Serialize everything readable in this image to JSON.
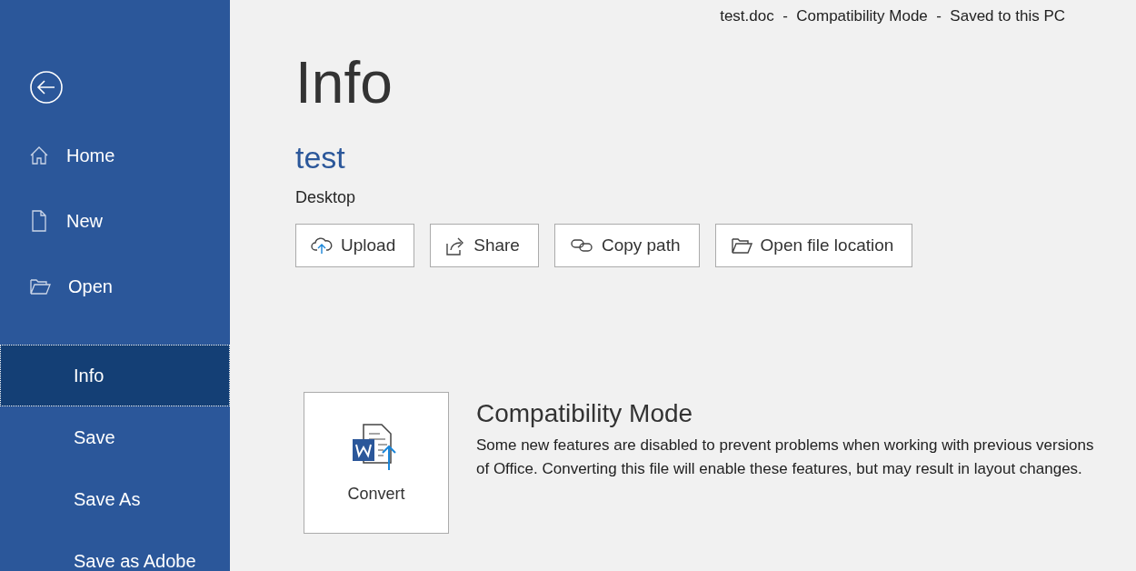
{
  "title_bar": {
    "text": "test.doc  -  Compatibility Mode  -  Saved to this PC"
  },
  "sidebar": {
    "top_items": [
      {
        "label": "Home",
        "kind": "home",
        "selected": false
      },
      {
        "label": "New",
        "kind": "new",
        "selected": false
      },
      {
        "label": "Open",
        "kind": "open",
        "selected": false
      }
    ],
    "items": [
      {
        "label": "Info",
        "selected": true
      },
      {
        "label": "Save",
        "selected": false
      },
      {
        "label": "Save As",
        "selected": false
      },
      {
        "label": "Save as Adobe",
        "selected": false
      }
    ]
  },
  "page": {
    "heading": "Info",
    "document_name": "test",
    "location": "Desktop",
    "actions": [
      {
        "label": "Upload",
        "kind": "upload"
      },
      {
        "label": "Share",
        "kind": "share"
      },
      {
        "label": "Copy path",
        "kind": "link"
      },
      {
        "label": "Open file location",
        "kind": "folder"
      }
    ],
    "section": {
      "button": "Convert",
      "title": "Compatibility Mode",
      "description": "Some new features are disabled to prevent problems when working with previous versions of Office. Converting this file will enable these features, but may result in layout changes."
    }
  }
}
